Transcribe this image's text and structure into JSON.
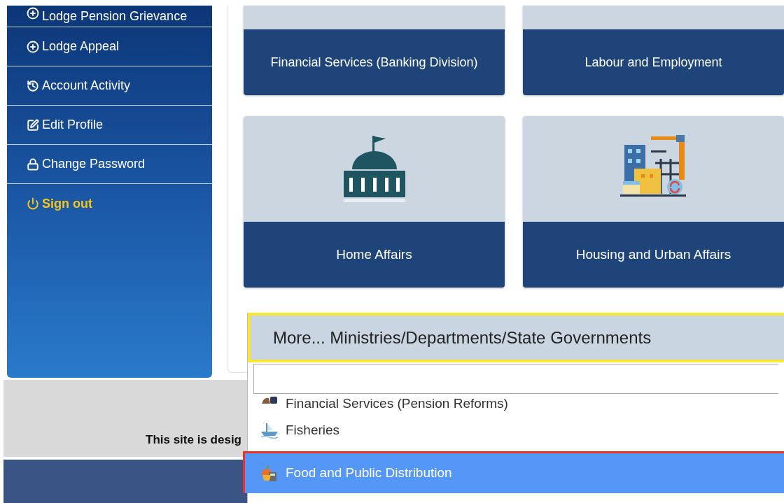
{
  "sidebar": {
    "items": [
      {
        "label": "Lodge Pension Grievance",
        "kind": "add"
      },
      {
        "label": "Lodge Appeal",
        "kind": "add"
      },
      {
        "label": "Account Activity",
        "kind": "history"
      },
      {
        "label": "Edit Profile",
        "kind": "edit"
      },
      {
        "label": "Change Password",
        "kind": "lock"
      },
      {
        "label": "Sign out",
        "kind": "signout"
      }
    ]
  },
  "cards": [
    {
      "label": "Financial Services (Banking Division)",
      "kind": "cut"
    },
    {
      "label": "Labour and Employment",
      "kind": "cut"
    },
    {
      "label": "Home Affairs",
      "kind": "capitol"
    },
    {
      "label": "Housing and Urban Affairs",
      "kind": "construction"
    }
  ],
  "footer": {
    "text": "This site is desig"
  },
  "dropdown": {
    "title": "More... Ministries/Departments/State Governments",
    "items": [
      {
        "label": "Financial Services (Pension Reforms)",
        "selected": false,
        "kind": "pension"
      },
      {
        "label": "Fisheries",
        "selected": false,
        "kind": "fish"
      },
      {
        "label": "Food and Public Distribution",
        "selected": true,
        "kind": "food"
      }
    ]
  }
}
